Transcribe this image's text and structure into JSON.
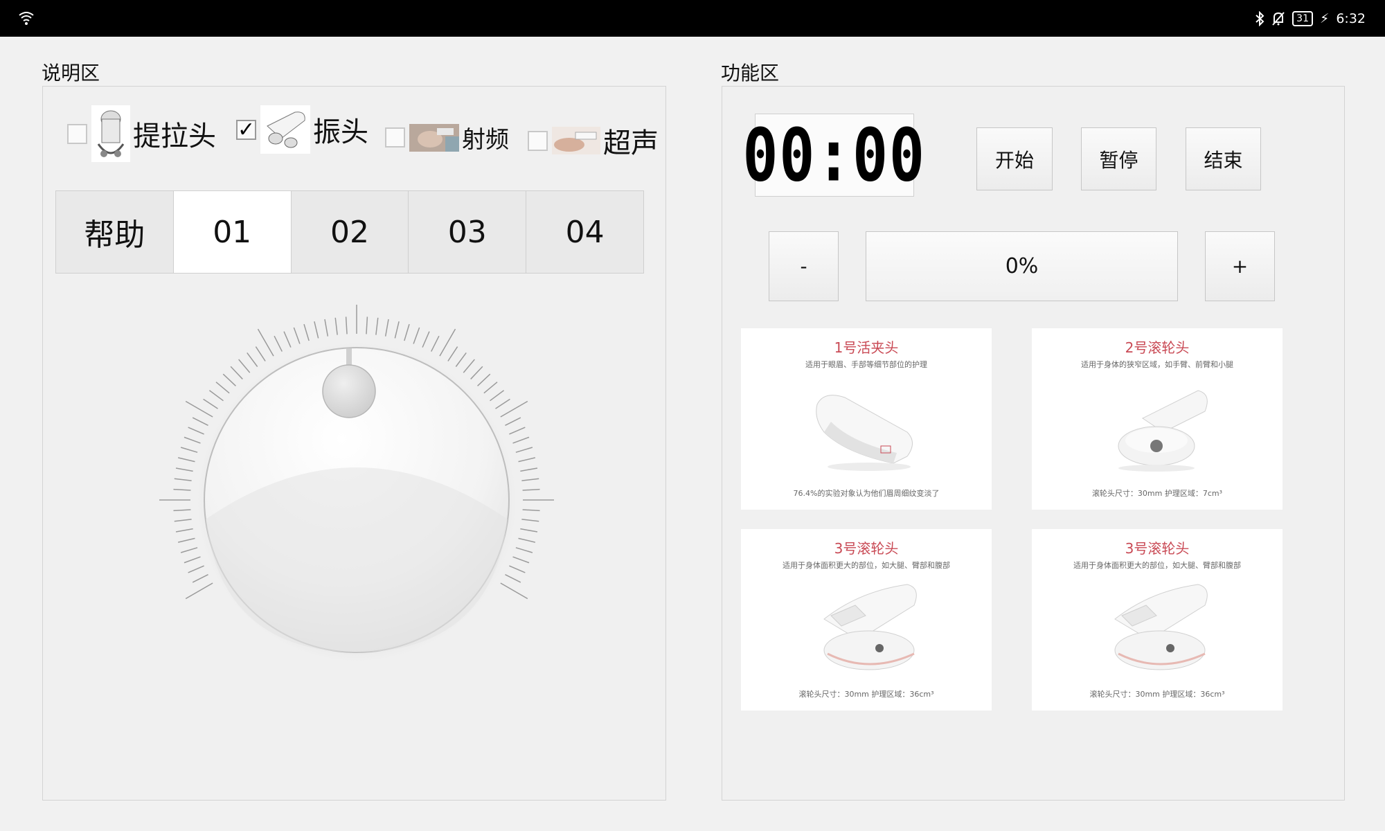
{
  "status_bar": {
    "time": "6:32",
    "battery": "31",
    "icons": [
      "wifi-icon",
      "bluetooth-icon",
      "notifications-off-icon",
      "battery-icon",
      "charging-icon"
    ]
  },
  "left": {
    "title": "说明区",
    "options": [
      {
        "label": "提拉头",
        "checked": false,
        "icon": "lifting-head-icon"
      },
      {
        "label": "振头",
        "checked": true,
        "icon": "vibration-head-icon"
      },
      {
        "label": "射频",
        "checked": false,
        "icon": "radio-frequency-icon"
      },
      {
        "label": "超声",
        "checked": false,
        "icon": "ultrasound-icon"
      }
    ],
    "check_mark": "✓",
    "tabs": [
      "帮助",
      "01",
      "02",
      "03",
      "04"
    ],
    "active_tab": "01"
  },
  "right": {
    "title": "功能区",
    "timer": "00:00",
    "buttons": {
      "start": "开始",
      "pause": "暂停",
      "stop": "结束"
    },
    "minus": "-",
    "plus": "+",
    "progress": "0%",
    "cards": [
      {
        "title": "1号活夹头",
        "subtitle": "适用于眼眉、手部等细节部位的护理",
        "footer": "76.4%的实验对象认为他们眉周细纹变淡了"
      },
      {
        "title": "2号滚轮头",
        "subtitle": "适用于身体的狭窄区域，如手臂、前臂和小腿",
        "footer": "滚轮头尺寸：30mm    护理区域：7cm³"
      },
      {
        "title": "3号滚轮头",
        "subtitle": "适用于身体面积更大的部位，如大腿、臂部和腹部",
        "footer": "滚轮头尺寸：30mm    护理区域：36cm³"
      },
      {
        "title": "3号滚轮头",
        "subtitle": "适用于身体面积更大的部位，如大腿、臂部和腹部",
        "footer": "滚轮头尺寸：30mm    护理区域：36cm³"
      }
    ]
  },
  "colors": {
    "accent_red": "#c94a55",
    "statusbar": "#000000",
    "background": "#f1f1f1"
  }
}
